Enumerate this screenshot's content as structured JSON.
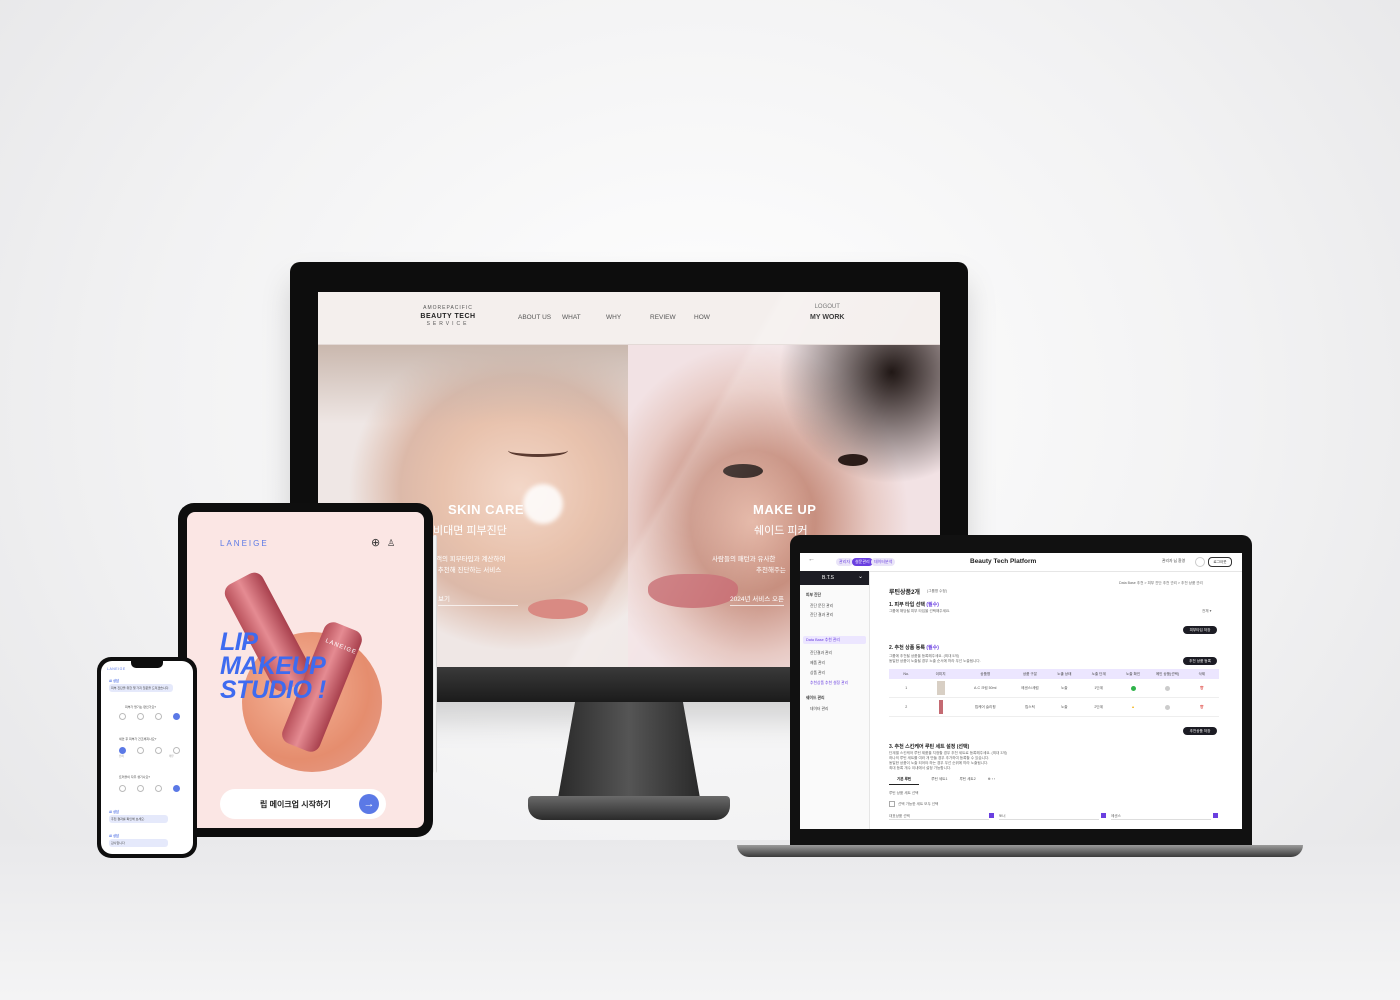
{
  "imac": {
    "logo": {
      "line1": "AMOREPACIFIC",
      "line2": "BEAUTY TECH",
      "line3": "SERVICE"
    },
    "nav": [
      "ABOUT US",
      "WHAT",
      "WHY",
      "REVIEW",
      "HOW"
    ],
    "logout": "LOGOUT",
    "my_work": "MY WORK",
    "left_panel": {
      "title": "SKIN CARE",
      "subtitle": "비대면 피부진단",
      "desc_1": "고객의 피부타입과 계산하여",
      "desc_2": "을 추천해 진단하는 서비스",
      "link": "보기"
    },
    "right_panel": {
      "title": "MAKE UP",
      "subtitle": "쉐이드 피커",
      "desc_1": "사람들의 패턴과 유사한",
      "desc_2": "추천해주는",
      "link": "2024년 서비스 오픈"
    }
  },
  "laptop": {
    "app_title": "Beauty Tech Platform",
    "top_pills": [
      "관리자",
      "설문관리",
      "데이터분석"
    ],
    "user": "관리자 님 환영",
    "logout_button": "로그아웃",
    "sidebar_head": "B.T.S",
    "sidebar_items": [
      "피부 진단",
      "진단 문진 관리",
      "진단 결과 관리",
      "Data Base 추천 관리",
      "진단결과 관리",
      "제품 관리",
      "상품 관리",
      "추천상품 추천 설정 관리",
      "쉐이드 관리",
      "데이터 관리"
    ],
    "breadcrumb": "Data Base 추천 > 피부 진단 추천 관리 > 추천 상품 관리",
    "page_title": "루틴상품2개",
    "page_title_note": "(그룹명 수정)",
    "section1": {
      "title": "1. 피부 타입 선택",
      "required": "(필수)",
      "desc": "그룹에 해당될 피부 타입을 선택해주세요.",
      "button": "피부타입 저장",
      "select": "전체 ▾"
    },
    "section2": {
      "title": "2. 추천 상품 등록",
      "required": "(필수)",
      "desc_1": "그룹에 추천될 상품을 등록해주세요. (최대 5개)",
      "desc_2": "동일한 상품이 노출될 경우 노출 순서에 따라 우선 노출됩니다.",
      "button": "추천 상품 등록",
      "save_button": "추천상품 저장"
    },
    "table": {
      "headers": [
        "No.",
        "이미지",
        "상품명",
        "상품 구분",
        "노출 상태",
        "노출 단계",
        "노출 확인",
        "메인 상품(선택)",
        "삭제"
      ],
      "rows": [
        {
          "no": "1",
          "name": "A.C 크림 50ml",
          "type": "에센스/세럼",
          "status": "노출",
          "stage": "1단계"
        },
        {
          "no": "2",
          "name": "립케어 슬리핑",
          "type": "립스틱",
          "status": "노출",
          "stage": "2단계"
        }
      ]
    },
    "section3": {
      "title": "3. 추천 스킨케어 루틴 세트 설정 (선택)",
      "desc_1": "단계별 스킨케어 루틴 제품을 지정할 경우 추천 세트로 등록해주세요. (최대 3개)",
      "desc_2": "하나의 루틴 세트를 여러 개 만들 경우 추가하여 등록할 수 있습니다.",
      "desc_3": "동일한 상품이 노출 되어야 하는 경우 우선 순위에 따라 노출됩니다.",
      "desc_4": "최대 등록 개수 이내에서 설정 가능합니다."
    },
    "tabs": [
      "기본 루틴",
      "루틴 세트1",
      "루틴 세트2"
    ],
    "routine_label": "루틴 상품 세트 선택",
    "checkbox_label": "선택 가능한 세트 모두 선택",
    "fields": [
      "대표상품 선택",
      "토너",
      "에센스"
    ]
  },
  "ipad": {
    "brand": "LANEIGE",
    "title_1": "LIP",
    "title_2": "MAKEUP",
    "title_3": "STUDIO !",
    "tube_label": "LANEIGE",
    "cta": "립 메이크업 시작하기"
  },
  "phone": {
    "brand": "LANEIGE",
    "bot": "AI 상담",
    "msg_1": "피부 진단을 위한 몇 가지 질문을 드리겠습니다.",
    "q1": "피부가 땅기는 편인가요?",
    "q2": "세안 후 피부가 건조해지나요?",
    "q3": "트러블이 자주 생기나요?",
    "scale_low": "전혀",
    "scale_high": "매우",
    "msg_2": "추천 결과를 확인해 보세요.",
    "msg_3": "감사합니다"
  },
  "colors": {
    "accent": "#6a3fe0",
    "laneige_blue": "#3e6bf0",
    "dark": "#1c1c24"
  }
}
